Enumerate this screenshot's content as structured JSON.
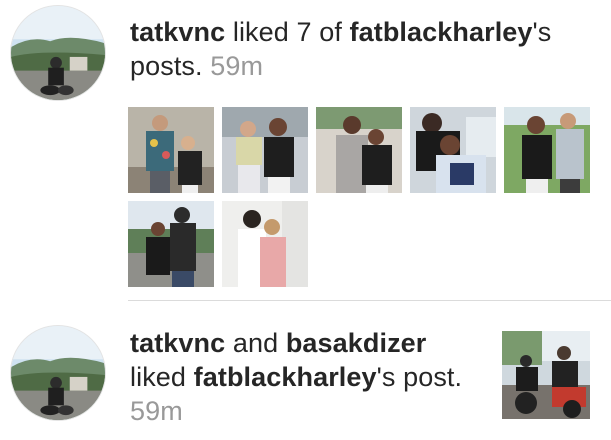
{
  "notifications": [
    {
      "username": "tatkvnc",
      "action": " liked 7 of ",
      "target_user": "fatblackharley",
      "suffix": "'s posts.",
      "time": "59m",
      "thumbnails": [
        "photo-man-floral-shirt-and-girl",
        "photo-girl-and-woman-black-jacket",
        "photo-woman-grey-coat-and-girl",
        "photo-hug-white-shirt",
        "photo-girl-and-man-grey-jacket",
        "photo-girl-and-man-outdoor-road",
        "photo-woman-and-girl-pink-dress"
      ]
    },
    {
      "username": "tatkvnc",
      "conjunction": " and ",
      "second_user": "basakdizer",
      "action": "liked ",
      "target_user": "fatblackharley",
      "suffix": "'s post.",
      "time": "59m",
      "thumbnail": "photo-motorcycle-riders"
    }
  ],
  "colors": {
    "text": "#262626",
    "time": "#999999",
    "divider": "#dbdbdb"
  }
}
